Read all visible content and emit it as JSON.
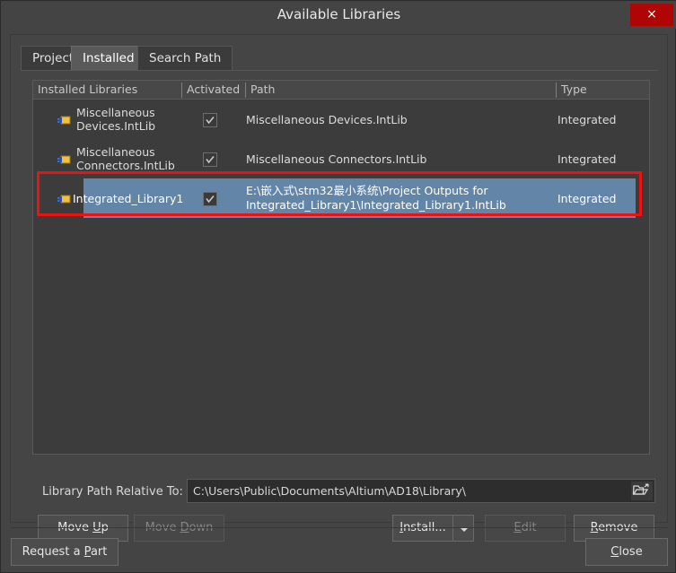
{
  "window": {
    "title": "Available Libraries",
    "close_icon": "close-x-icon",
    "close_label": "×"
  },
  "tabs": [
    {
      "label": "Project",
      "active": false
    },
    {
      "label": "Installed",
      "active": true
    },
    {
      "label": "Search Path",
      "active": false
    }
  ],
  "table": {
    "columns": [
      {
        "label": "Installed Libraries"
      },
      {
        "label": "Activated"
      },
      {
        "label": "Path"
      },
      {
        "label": "Type"
      }
    ],
    "rows": [
      {
        "name": "Miscellaneous\nDevices.IntLib",
        "activated": true,
        "path": "Miscellaneous Devices.IntLib",
        "type": "Integrated",
        "selected": false,
        "icon": "library-icon"
      },
      {
        "name": "Miscellaneous\nConnectors.IntLib",
        "activated": true,
        "path": "Miscellaneous Connectors.IntLib",
        "type": "Integrated",
        "selected": false,
        "icon": "library-icon"
      },
      {
        "name": "Integrated_Library1",
        "activated": true,
        "path": "E:\\嵌入式\\stm32最小系统\\Project Outputs for\nIntegrated_Library1\\Integrated_Library1.IntLib",
        "type": "Integrated",
        "selected": true,
        "icon": "library-icon"
      }
    ]
  },
  "path_row": {
    "label": "Library Path Relative To:",
    "value": "C:\\Users\\Public\\Documents\\Altium\\AD18\\Library\\",
    "browse_icon": "open-folder-icon"
  },
  "buttons": {
    "move_up": {
      "label": "Move Up",
      "mnemonic": "U",
      "enabled": true
    },
    "move_down": {
      "label": "Move Down",
      "mnemonic": "D",
      "enabled": false
    },
    "install": {
      "label": "Install...",
      "mnemonic": "I",
      "enabled": true
    },
    "install_dropdown_icon": "chevron-down-icon",
    "edit": {
      "label": "Edit",
      "mnemonic": "E",
      "enabled": false
    },
    "remove": {
      "label": "Remove",
      "mnemonic": "R",
      "enabled": true
    },
    "request_a_part": {
      "label": "Request a Part",
      "mnemonic": "P",
      "enabled": true
    },
    "close": {
      "label": "Close",
      "mnemonic": "C",
      "enabled": true
    }
  },
  "colors": {
    "dialog_bg": "#444444",
    "list_bg": "#3c3c3c",
    "selection": "#6285a8",
    "close_red": "#b00505",
    "highlight_rect": "#ee1111",
    "text": "#dcdcdc"
  }
}
